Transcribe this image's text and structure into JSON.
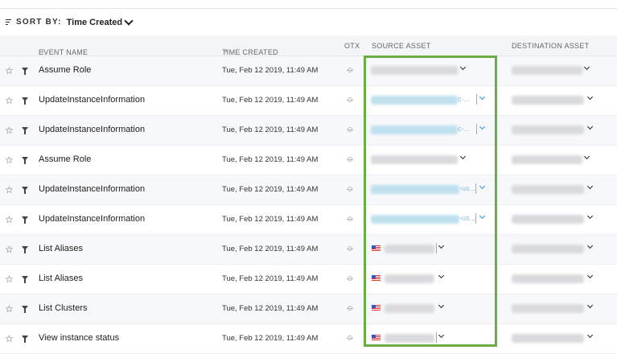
{
  "sort": {
    "label": "SORT BY:",
    "value": "Time Created"
  },
  "columns": {
    "event_name": "EVENT NAME",
    "time_created": "TIME CREATED",
    "otx": "OTX",
    "source_asset": "SOURCE ASSET",
    "destination_asset": "DESTINATION ASSET"
  },
  "sort_glyphs": {
    "event_name": "⇕",
    "time_created": "▲"
  },
  "rows": [
    {
      "event": "Assume Role",
      "time": "Tue, Feb 12 2019, 11:49 AM",
      "source_suffix": ""
    },
    {
      "event": "UpdateInstanceInformation",
      "time": "Tue, Feb 12 2019, 11:49 AM",
      "source_suffix": "c-..."
    },
    {
      "event": "UpdateInstanceInformation",
      "time": "Tue, Feb 12 2019, 11:49 AM",
      "source_suffix": "c-..."
    },
    {
      "event": "Assume Role",
      "time": "Tue, Feb 12 2019, 11:49 AM",
      "source_suffix": ""
    },
    {
      "event": "UpdateInstanceInformation",
      "time": "Tue, Feb 12 2019, 11:49 AM",
      "source_suffix": "-us..."
    },
    {
      "event": "UpdateInstanceInformation",
      "time": "Tue, Feb 12 2019, 11:49 AM",
      "source_suffix": "-us..."
    },
    {
      "event": "List Aliases",
      "time": "Tue, Feb 12 2019, 11:49 AM",
      "source_suffix": ""
    },
    {
      "event": "List Aliases",
      "time": "Tue, Feb 12 2019, 11:49 AM",
      "source_suffix": ""
    },
    {
      "event": "List Clusters",
      "time": "Tue, Feb 12 2019, 11:49 AM",
      "source_suffix": ""
    },
    {
      "event": "View instance status",
      "time": "Tue, Feb 12 2019, 11:49 AM",
      "source_suffix": ""
    }
  ],
  "icons": {
    "sort": "sort-lines-icon",
    "star": "star-outline-icon",
    "filter": "filter-icon",
    "otx": "otx-crosshair-icon",
    "chevron": "chevron-down-icon",
    "flag": "us-flag-icon"
  },
  "colors": {
    "highlight": "#6aad45",
    "link_blue": "#2b8fd0",
    "row_alt": "#f7f8fa",
    "header_bg": "#f4f5f7"
  }
}
